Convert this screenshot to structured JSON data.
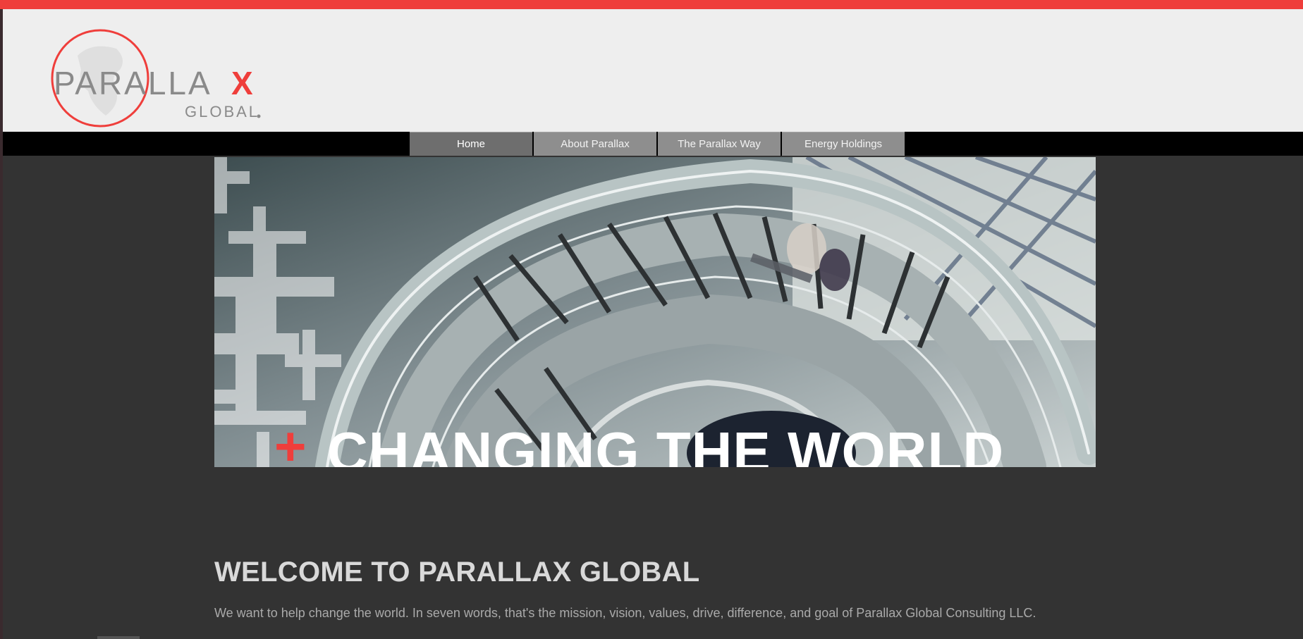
{
  "brand": {
    "name_main": "PARALLA",
    "name_x": "X",
    "name_sub": "GLOBAL",
    "accent_color": "#ef3e3b"
  },
  "nav": {
    "items": [
      {
        "label": "Home",
        "active": true
      },
      {
        "label": "About Parallax",
        "active": false
      },
      {
        "label": "The Parallax Way",
        "active": false
      },
      {
        "label": "Energy Holdings",
        "active": false
      }
    ]
  },
  "hero": {
    "caption_plus": "+",
    "caption": "CHANGING THE WORLD",
    "image_subject": "spiral-staircase-photo"
  },
  "main": {
    "title": "WELCOME TO PARALLAX GLOBAL",
    "intro": "We want to help change the world. In seven words, that's the mission, vision, values, drive, difference, and goal of Parallax Global Consulting LLC."
  }
}
